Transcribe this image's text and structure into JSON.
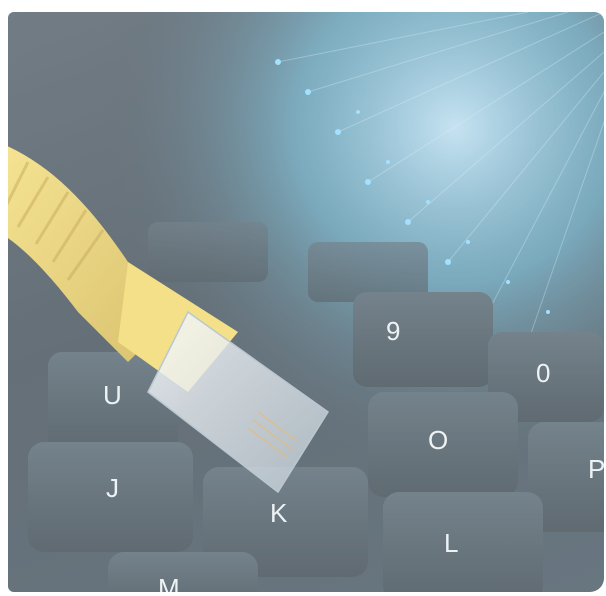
{
  "image": {
    "subject": "photo",
    "keyboard": {
      "keys": [
        {
          "label": "U"
        },
        {
          "label": "J"
        },
        {
          "label": "K"
        },
        {
          "label": "O"
        },
        {
          "label": "L"
        },
        {
          "label": "P"
        },
        {
          "label": "M"
        },
        {
          "label": "9"
        },
        {
          "label": "0"
        }
      ]
    },
    "colors": {
      "cable": "#e8c94a",
      "fiber_glow": "#5ec8ee",
      "keycap": "#2c3a44",
      "key_highlight": "#5a8fa5"
    }
  }
}
